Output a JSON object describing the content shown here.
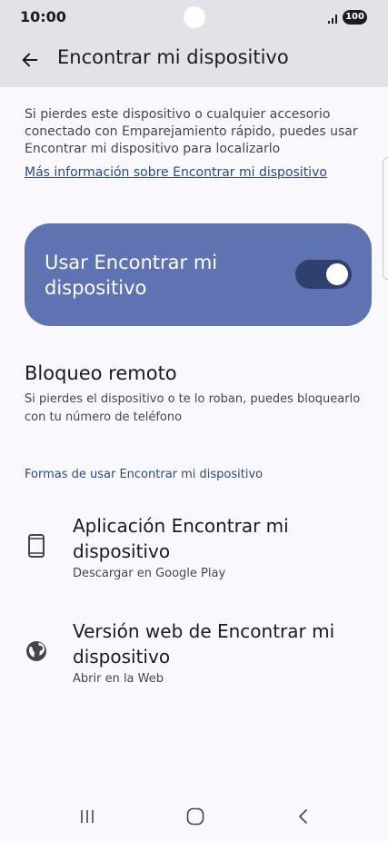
{
  "status_bar": {
    "time": "10:00",
    "battery": "100",
    "icons": [
      "signal-icon",
      "battery-icon"
    ]
  },
  "app_bar": {
    "title": "Encontrar mi dispositivo",
    "back_icon": "arrow-left-icon"
  },
  "intro": {
    "text": "Si pierdes este dispositivo o cualquier accesorio conectado con Emparejamiento rápido, puedes usar Encontrar mi dispositivo para localizarlo",
    "link": "Más información sobre Encontrar mi dispositivo"
  },
  "main_toggle": {
    "label": "Usar Encontrar mi dispositivo",
    "checked": true,
    "color": "#5f72b2"
  },
  "remote_lock": {
    "title": "Bloqueo remoto",
    "description": "Si pierdes el dispositivo o te lo roban, puedes bloquearlo con tu número de teléfono"
  },
  "ways_section": {
    "header": "Formas de usar Encontrar mi dispositivo",
    "options": [
      {
        "icon": "phone-icon",
        "title": "Aplicación Encontrar mi dispositivo",
        "subtitle": "Descargar en Google Play"
      },
      {
        "icon": "globe-icon",
        "title": "Versión web de Encontrar mi dispositivo",
        "subtitle": "Abrir en la Web"
      }
    ]
  },
  "nav_bar": {
    "buttons": [
      "recents-icon",
      "home-icon",
      "back-icon"
    ]
  },
  "colors": {
    "accent": "#2d4a86",
    "header_bg": "#e2e2e8",
    "page_bg": "#f9f9fd"
  }
}
